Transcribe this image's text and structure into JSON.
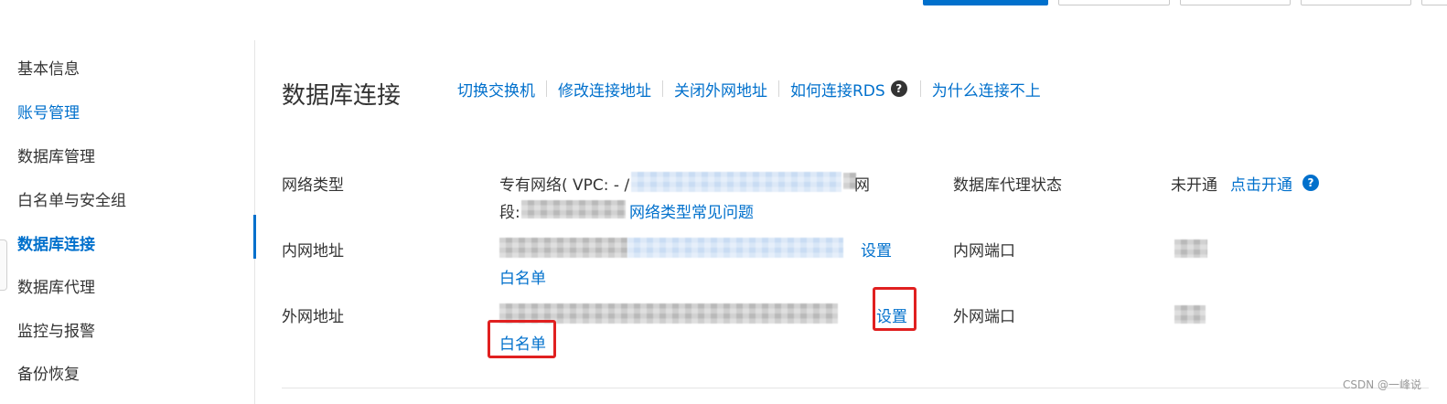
{
  "sidebar": {
    "items": [
      {
        "label": "基本信息"
      },
      {
        "label": "账号管理"
      },
      {
        "label": "数据库管理"
      },
      {
        "label": "白名单与安全组"
      },
      {
        "label": "数据库连接"
      },
      {
        "label": "数据库代理"
      },
      {
        "label": "监控与报警"
      },
      {
        "label": "备份恢复"
      }
    ],
    "active_item": "数据库连接"
  },
  "header": {
    "title": "数据库连接",
    "links": {
      "switch_vswitch": "切换交换机",
      "modify_address": "修改连接地址",
      "close_public": "关闭外网地址",
      "how_to_connect": "如何连接RDS",
      "why_cannot_connect": "为什么连接不上"
    },
    "help_glyph": "?"
  },
  "network_type": {
    "label": "网络类型",
    "value_prefix": "专有网络( VPC: - /",
    "value_line2_prefix": "段:",
    "value_line1_tail": "网",
    "faq_link": "网络类型常见问题"
  },
  "proxy_status": {
    "label": "数据库代理状态",
    "value": "未开通",
    "enable_link": "点击开通",
    "help_glyph": "?"
  },
  "intranet": {
    "label": "内网地址",
    "settings_link": "设置",
    "whitelist_link": "白名单",
    "port_label": "内网端口"
  },
  "public": {
    "label": "外网地址",
    "settings_link": "设置",
    "whitelist_link": "白名单",
    "port_label": "外网端口"
  },
  "watermark": "CSDN @一峰说",
  "colors": {
    "link": "#0070cc",
    "highlight": "#e02020",
    "text": "#333333"
  }
}
